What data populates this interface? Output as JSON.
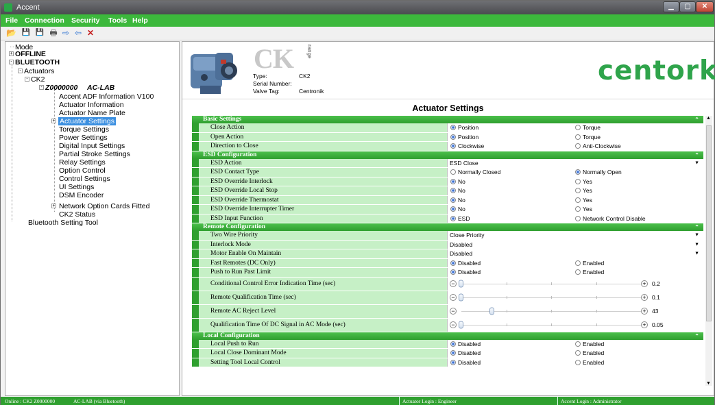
{
  "window": {
    "title": "Accent"
  },
  "menu": [
    "File",
    "Connection",
    "Security",
    "Tools",
    "Help"
  ],
  "toolbar": [
    {
      "name": "open-icon",
      "glyph": "📂"
    },
    {
      "name": "save-icon",
      "glyph": "💾"
    },
    {
      "name": "save-as-icon",
      "glyph": "💾"
    },
    {
      "name": "print-icon",
      "glyph": "🖶"
    },
    {
      "name": "forward-arrow-icon",
      "glyph": "⇨"
    },
    {
      "name": "back-arrow-icon",
      "glyph": "⇦"
    },
    {
      "name": "delete-icon",
      "glyph": "✕"
    }
  ],
  "tree": {
    "mode": "Mode",
    "offline": "OFFLINE",
    "bluetooth": "BLUETOOTH",
    "actuators": "Actuators",
    "ck2": "CK2",
    "device_serial": "Z0000000",
    "device_name": "AC-LAB",
    "children": [
      "Accent ADF Information V100",
      "Actuator Information",
      "Actuator Name Plate",
      "Actuator Settings",
      "Torque Settings",
      "Power Settings",
      "Digital Input Settings",
      "Partial Stroke Settings",
      "Relay Settings",
      "Option Control",
      "Control Settings",
      "UI Settings",
      "DSM Encoder",
      "Network Option Cards Fitted",
      "CK2 Status"
    ],
    "bluetooth_tool": "Bluetooth Setting Tool"
  },
  "header": {
    "ck_logo": "CK",
    "range_text": "range",
    "type_label": "Type:",
    "type_value": "CK2",
    "serial_label": "Serial Number:",
    "serial_value": "",
    "tag_label": "Valve Tag:",
    "tag_value": "Centronik",
    "brand": "centork"
  },
  "settings_title": "Actuator Settings",
  "sections": [
    {
      "title": "Basic Settings",
      "rows": [
        {
          "label": "Close Action",
          "kind": "radio",
          "options": [
            "Position",
            "Torque"
          ],
          "selected": 0
        },
        {
          "label": "Open Action",
          "kind": "radio",
          "options": [
            "Position",
            "Torque"
          ],
          "selected": 0
        },
        {
          "label": "Direction to Close",
          "kind": "radio",
          "options": [
            "Clockwise",
            "Anti-Clockwise"
          ],
          "selected": 0
        }
      ]
    },
    {
      "title": "ESD Configuration",
      "rows": [
        {
          "label": "ESD Action",
          "kind": "dropdown",
          "value": "ESD Close"
        },
        {
          "label": "ESD Contact Type",
          "kind": "radio",
          "options": [
            "Normally Closed",
            "Normally Open"
          ],
          "selected": 1
        },
        {
          "label": "ESD Override Interlock",
          "kind": "radio",
          "options": [
            "No",
            "Yes"
          ],
          "selected": 0
        },
        {
          "label": "ESD Override Local Stop",
          "kind": "radio",
          "options": [
            "No",
            "Yes"
          ],
          "selected": 0
        },
        {
          "label": "ESD Override Thermostat",
          "kind": "radio",
          "options": [
            "No",
            "Yes"
          ],
          "selected": 0
        },
        {
          "label": "ESD Override Interrupter Timer",
          "kind": "radio",
          "options": [
            "No",
            "Yes"
          ],
          "selected": 0
        },
        {
          "label": "ESD Input Function",
          "kind": "radio",
          "options": [
            "ESD",
            "Network Control Disable"
          ],
          "selected": 0
        }
      ]
    },
    {
      "title": "Remote Configuration",
      "rows": [
        {
          "label": "Two Wire Priority",
          "kind": "dropdown",
          "value": "Close Priority"
        },
        {
          "label": "Interlock Mode",
          "kind": "dropdown",
          "value": "Disabled"
        },
        {
          "label": "Motor Enable On Maintain",
          "kind": "dropdown",
          "value": "Disabled"
        },
        {
          "label": "Fast Remotes (DC Only)",
          "kind": "radio",
          "options": [
            "Disabled",
            "Enabled"
          ],
          "selected": 0
        },
        {
          "label": "Push to Run Past Limit",
          "kind": "radio",
          "options": [
            "Disabled",
            "Enabled"
          ],
          "selected": 0
        },
        {
          "label": "Conditional Control Error Indication Time (sec)",
          "kind": "slider",
          "value": "0.2",
          "level": 0.0
        },
        {
          "label": "Remote Qualification Time (sec)",
          "kind": "slider",
          "value": "0.1",
          "level": 0.0
        },
        {
          "label": "Remote AC Reject Level",
          "kind": "slider",
          "value": "43",
          "level": 0.17
        },
        {
          "label": "Qualification Time Of DC Signal in AC Mode (sec)",
          "kind": "slider",
          "value": "0.05",
          "level": 0.0
        }
      ]
    },
    {
      "title": "Local Configuration",
      "rows": [
        {
          "label": "Local Push to Run",
          "kind": "radio",
          "options": [
            "Disabled",
            "Enabled"
          ],
          "selected": 0
        },
        {
          "label": "Local Close Dominant Mode",
          "kind": "radio",
          "options": [
            "Disabled",
            "Enabled"
          ],
          "selected": 0
        },
        {
          "label": "Setting Tool Local Control",
          "kind": "radio",
          "options": [
            "Disabled",
            "Enabled"
          ],
          "selected": 0
        }
      ]
    }
  ],
  "status": {
    "online": "Online : CK2 Z0000000",
    "device": "AC-LAB (via Bluetooth)",
    "actuator_login": "Actuator Login : Engineer",
    "accent_login": "Accent Login : Administrator"
  },
  "colors": {
    "accent_green": "#3cb83c",
    "row_green": "#c6f0c6",
    "brand_green": "#2fa44b"
  }
}
